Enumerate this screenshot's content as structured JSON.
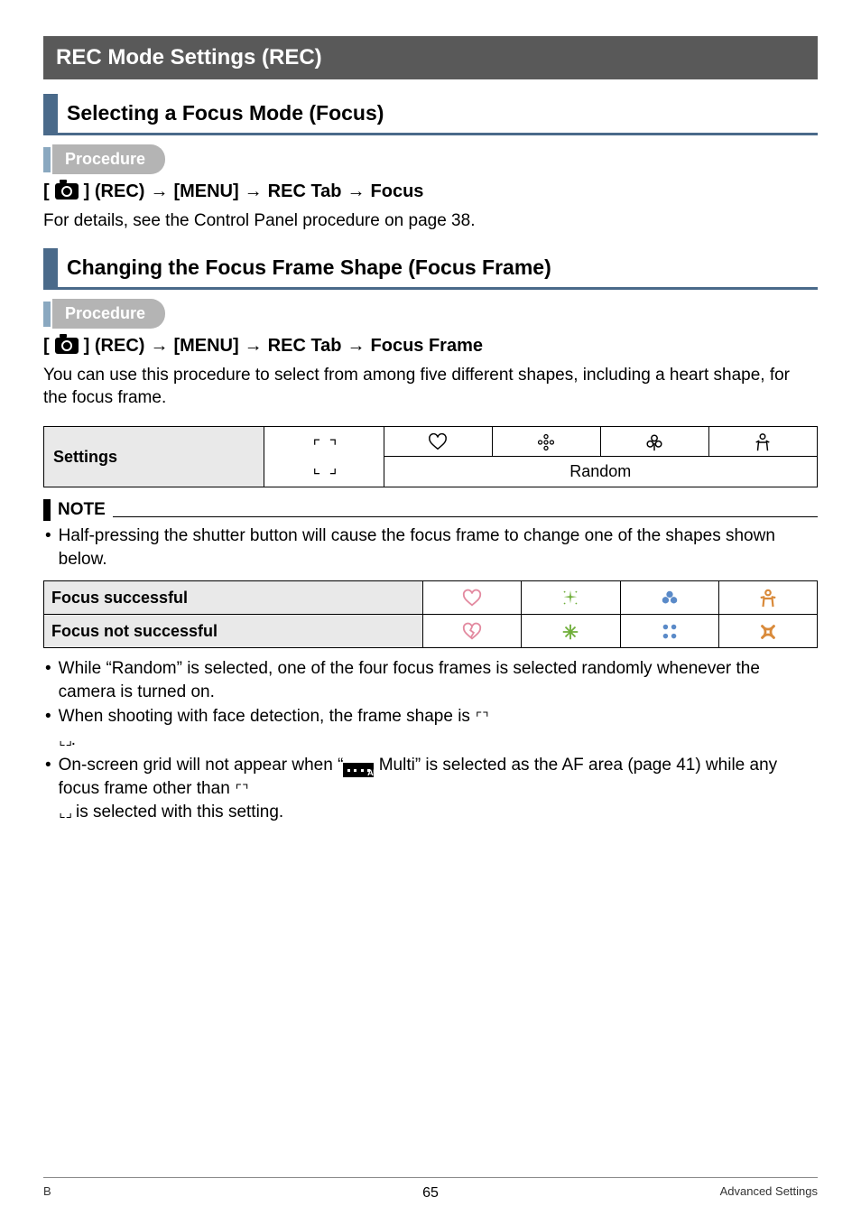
{
  "h1": "REC Mode Settings (REC)",
  "section1": {
    "title": "Selecting a Focus Mode (Focus)",
    "procedure_label": "Procedure",
    "path_prefix": "[",
    "path_suffix": "] (REC)",
    "path_parts": [
      "[MENU]",
      "REC Tab",
      "Focus"
    ],
    "arrow": "→",
    "body": "For details, see the Control Panel procedure on page 38."
  },
  "section2": {
    "title": "Changing the Focus Frame Shape (Focus Frame)",
    "procedure_label": "Procedure",
    "path_prefix": "[",
    "path_suffix": "] (REC)",
    "path_parts": [
      "[MENU]",
      "REC Tab",
      "Focus Frame"
    ],
    "arrow": "→",
    "body": "You can use this procedure to select from among five different shapes, including a heart shape, for the focus frame."
  },
  "settings_table": {
    "label": "Settings",
    "bracket_icon": "[ ]",
    "random_label": "Random"
  },
  "note": {
    "label": "NOTE",
    "items": [
      "Half-pressing the shutter button will cause the focus frame to change one of the shapes shown below."
    ]
  },
  "focus_table": {
    "row1_label": "Focus successful",
    "row2_label": "Focus not successful"
  },
  "bullets": [
    {
      "pre": "While “Random” is selected, one of the four focus frames is selected randomly whenever the camera is turned on."
    },
    {
      "pre": "When shooting with face detection, the frame shape is ",
      "icon": "brackets",
      "post": "."
    },
    {
      "pre": "On-screen grid will not appear when “",
      "icon": "multiAF",
      "mid": " Multi” is selected as the AF area (page 41) while any focus frame other than ",
      "icon2": "brackets",
      "post": " is selected with this setting."
    }
  ],
  "footer": {
    "left": "B",
    "center": "65",
    "right": "Advanced Settings"
  }
}
